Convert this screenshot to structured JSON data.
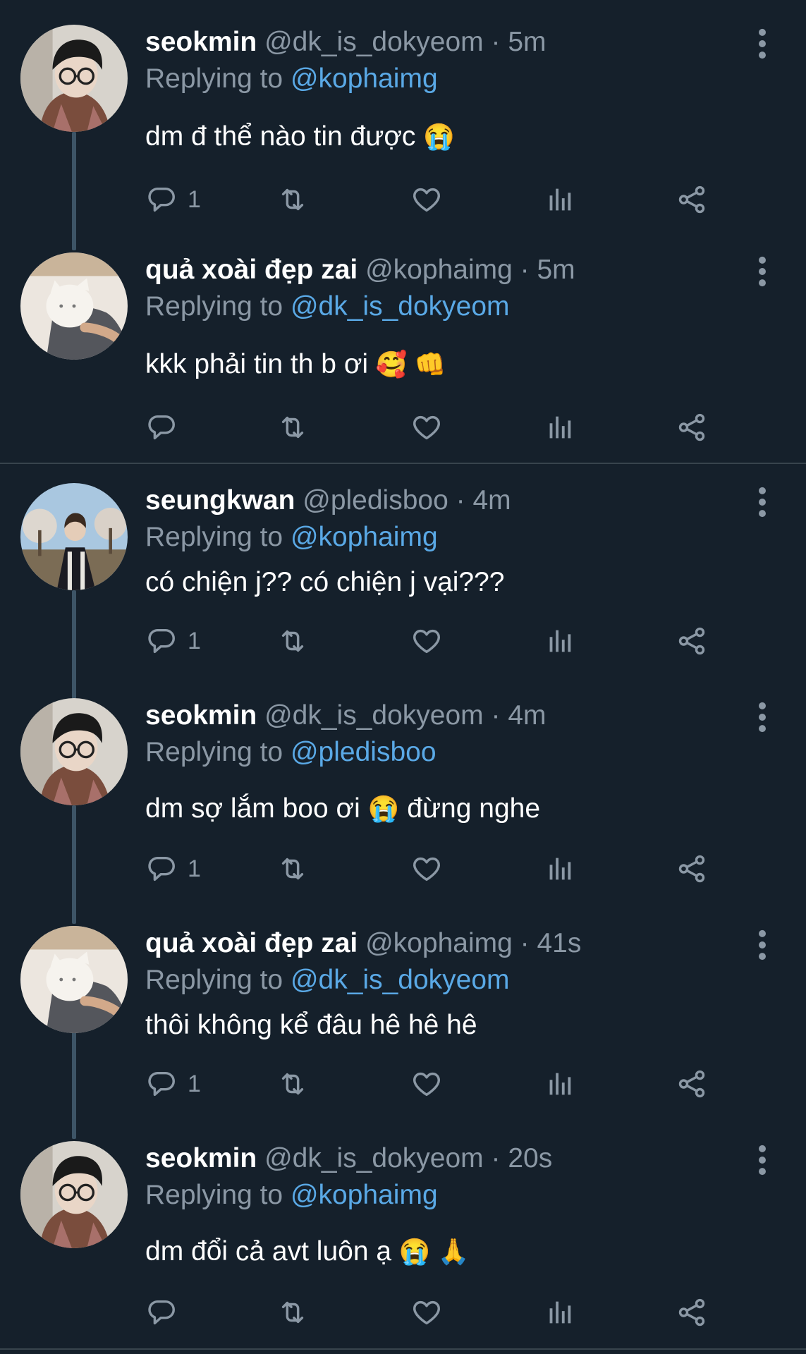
{
  "tweets": [
    {
      "name": "seokmin",
      "handle": "@dk_is_dokyeom",
      "time": "5m",
      "reply_prefix": "Replying to ",
      "reply_to": "@kophaimg",
      "text": "dm đ thể nào tin được",
      "emoji": "😭",
      "reply_count": "1",
      "avatar": "person-glasses-avatar"
    },
    {
      "name": "quả xoài đẹp zai",
      "handle": "@kophaimg",
      "time": "5m",
      "reply_prefix": "Replying to ",
      "reply_to": "@dk_is_dokyeom",
      "text": "kkk phải tin th b ơi",
      "emoji": "🥰 👊",
      "reply_count": "",
      "avatar": "white-cat-avatar"
    },
    {
      "name": "seungkwan",
      "handle": "@pledisboo",
      "time": "4m",
      "reply_prefix": "Replying to ",
      "reply_to": "@kophaimg",
      "text": "có chiện j?? có chiện j vại???",
      "emoji": "",
      "reply_count": "1",
      "avatar": "person-trees-avatar"
    },
    {
      "name": "seokmin",
      "handle": "@dk_is_dokyeom",
      "time": "4m",
      "reply_prefix": "Replying to ",
      "reply_to": "@pledisboo",
      "text": "dm sợ lắm boo ơi",
      "emoji": "😭",
      "text_after": " đừng nghe",
      "reply_count": "1",
      "avatar": "person-glasses-avatar"
    },
    {
      "name": "quả xoài đẹp zai",
      "handle": "@kophaimg",
      "time": "41s",
      "reply_prefix": "Replying to ",
      "reply_to": "@dk_is_dokyeom",
      "text": "thôi không kể đâu hê hê hê",
      "emoji": "",
      "reply_count": "1",
      "avatar": "white-cat-avatar"
    },
    {
      "name": "seokmin",
      "handle": "@dk_is_dokyeom",
      "time": "20s",
      "reply_prefix": "Replying to ",
      "reply_to": "@kophaimg",
      "text": "dm đổi cả avt luôn ạ",
      "emoji": "😭 🙏",
      "reply_count": "",
      "avatar": "person-glasses-avatar"
    }
  ],
  "colors": {
    "background": "#15202b",
    "mention": "#5aa9e6",
    "muted": "#8b98a5",
    "thread_line": "#3d5466"
  }
}
